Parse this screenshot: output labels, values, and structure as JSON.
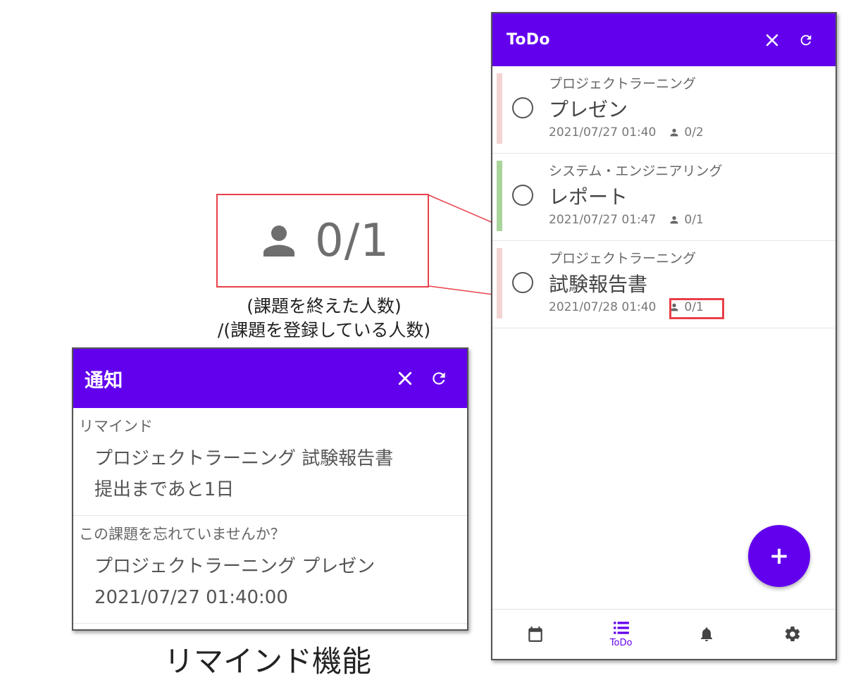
{
  "todo": {
    "title": "ToDo",
    "tasks": [
      {
        "course": "プロジェクトラーニング",
        "name": "プレゼン",
        "due": "2021/07/27 01:40",
        "people": "0/2",
        "color": "#f3d4d2"
      },
      {
        "course": "システム・エンジニアリング",
        "name": "レポート",
        "due": "2021/07/27 01:47",
        "people": "0/1",
        "color": "#a9d49a"
      },
      {
        "course": "プロジェクトラーニング",
        "name": "試験報告書",
        "due": "2021/07/28 01:40",
        "people": "0/1",
        "color": "#f3d4d2"
      }
    ],
    "fab_label": "+",
    "nav": {
      "active_label": "ToDo"
    }
  },
  "zoom": {
    "text": "0/1"
  },
  "caption1": {
    "line1": "(課題を終えた人数)",
    "line2": "/(課題を登録している人数)"
  },
  "notifications": {
    "title": "通知",
    "items": [
      {
        "head": "リマインド",
        "line1": "プロジェクトラーニング 試験報告書",
        "line2": "提出まであと1日"
      },
      {
        "head": "この課題を忘れていませんか？",
        "line1": "プロジェクトラーニング プレゼン",
        "line2": "2021/07/27 01:40:00"
      }
    ]
  },
  "caption2": "リマインド機能",
  "colors": {
    "primary": "#6200ee",
    "highlight": "#e8404a"
  }
}
